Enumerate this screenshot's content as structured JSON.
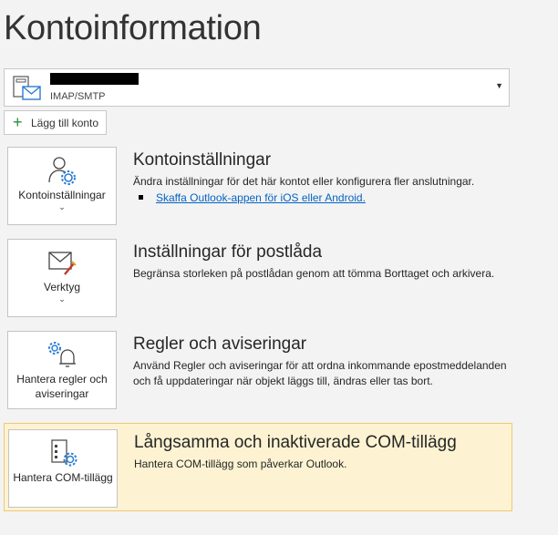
{
  "page": {
    "title": "Kontoinformation"
  },
  "account": {
    "type": "IMAP/SMTP"
  },
  "add_account": {
    "label": "Lägg till konto"
  },
  "sections": [
    {
      "tile_label": "Kontoinställningar",
      "title": "Kontoinställningar",
      "description": "Ändra inställningar för det här kontot eller konfigurera fler anslutningar.",
      "link": "Skaffa Outlook-appen för iOS eller Android."
    },
    {
      "tile_label": "Verktyg",
      "title": "Inställningar för postlåda",
      "description": "Begränsa storleken på postlådan genom att tömma Borttaget och arkivera."
    },
    {
      "tile_label": "Hantera regler och aviseringar",
      "title": "Regler och aviseringar",
      "description": "Använd Regler och aviseringar för att ordna inkommande epostmeddelanden och få uppdateringar när objekt läggs till, ändras eller tas bort."
    },
    {
      "tile_label": "Hantera COM-tillägg",
      "title": "Långsamma och inaktiverade COM-tillägg",
      "description": "Hantera COM-tillägg som påverkar Outlook."
    }
  ],
  "colors": {
    "link": "#0563c1",
    "highlight_bg": "#fdf3d2",
    "highlight_border": "#f0c874",
    "accent": "#2b7cd3"
  }
}
